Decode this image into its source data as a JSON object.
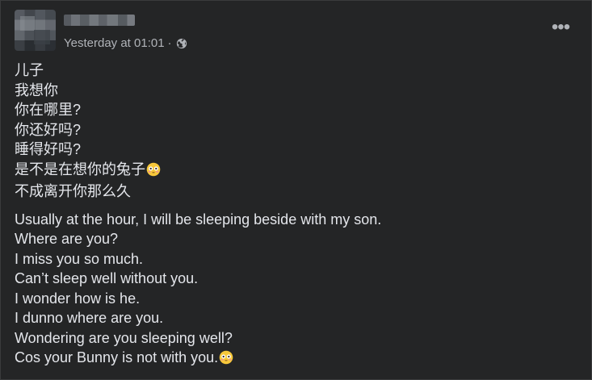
{
  "post": {
    "timestamp": "Yesterday at 01:01",
    "separator": "·",
    "privacy_icon": "globe-icon",
    "menu_icon": "more-horizontal-icon",
    "content": {
      "chinese_lines": [
        "儿子",
        "我想你",
        "你在哪里?",
        "你还好吗?",
        "睡得好吗?",
        "是不是在想你的兔子",
        "不成离开你那么久"
      ],
      "english_lines": [
        "Usually at the hour, I will be sleeping beside with my son.",
        "Where are you?",
        "I miss you so much.",
        "Can’t sleep well without you.",
        "I wonder how is he.",
        "I dunno where are you.",
        "Wondering are you sleeping well?",
        "Cos your Bunny is not with you."
      ],
      "emoji": "flushed-face"
    }
  },
  "colors": {
    "background": "#242526",
    "text": "#e4e6eb",
    "secondary_text": "#b0b3b8"
  }
}
